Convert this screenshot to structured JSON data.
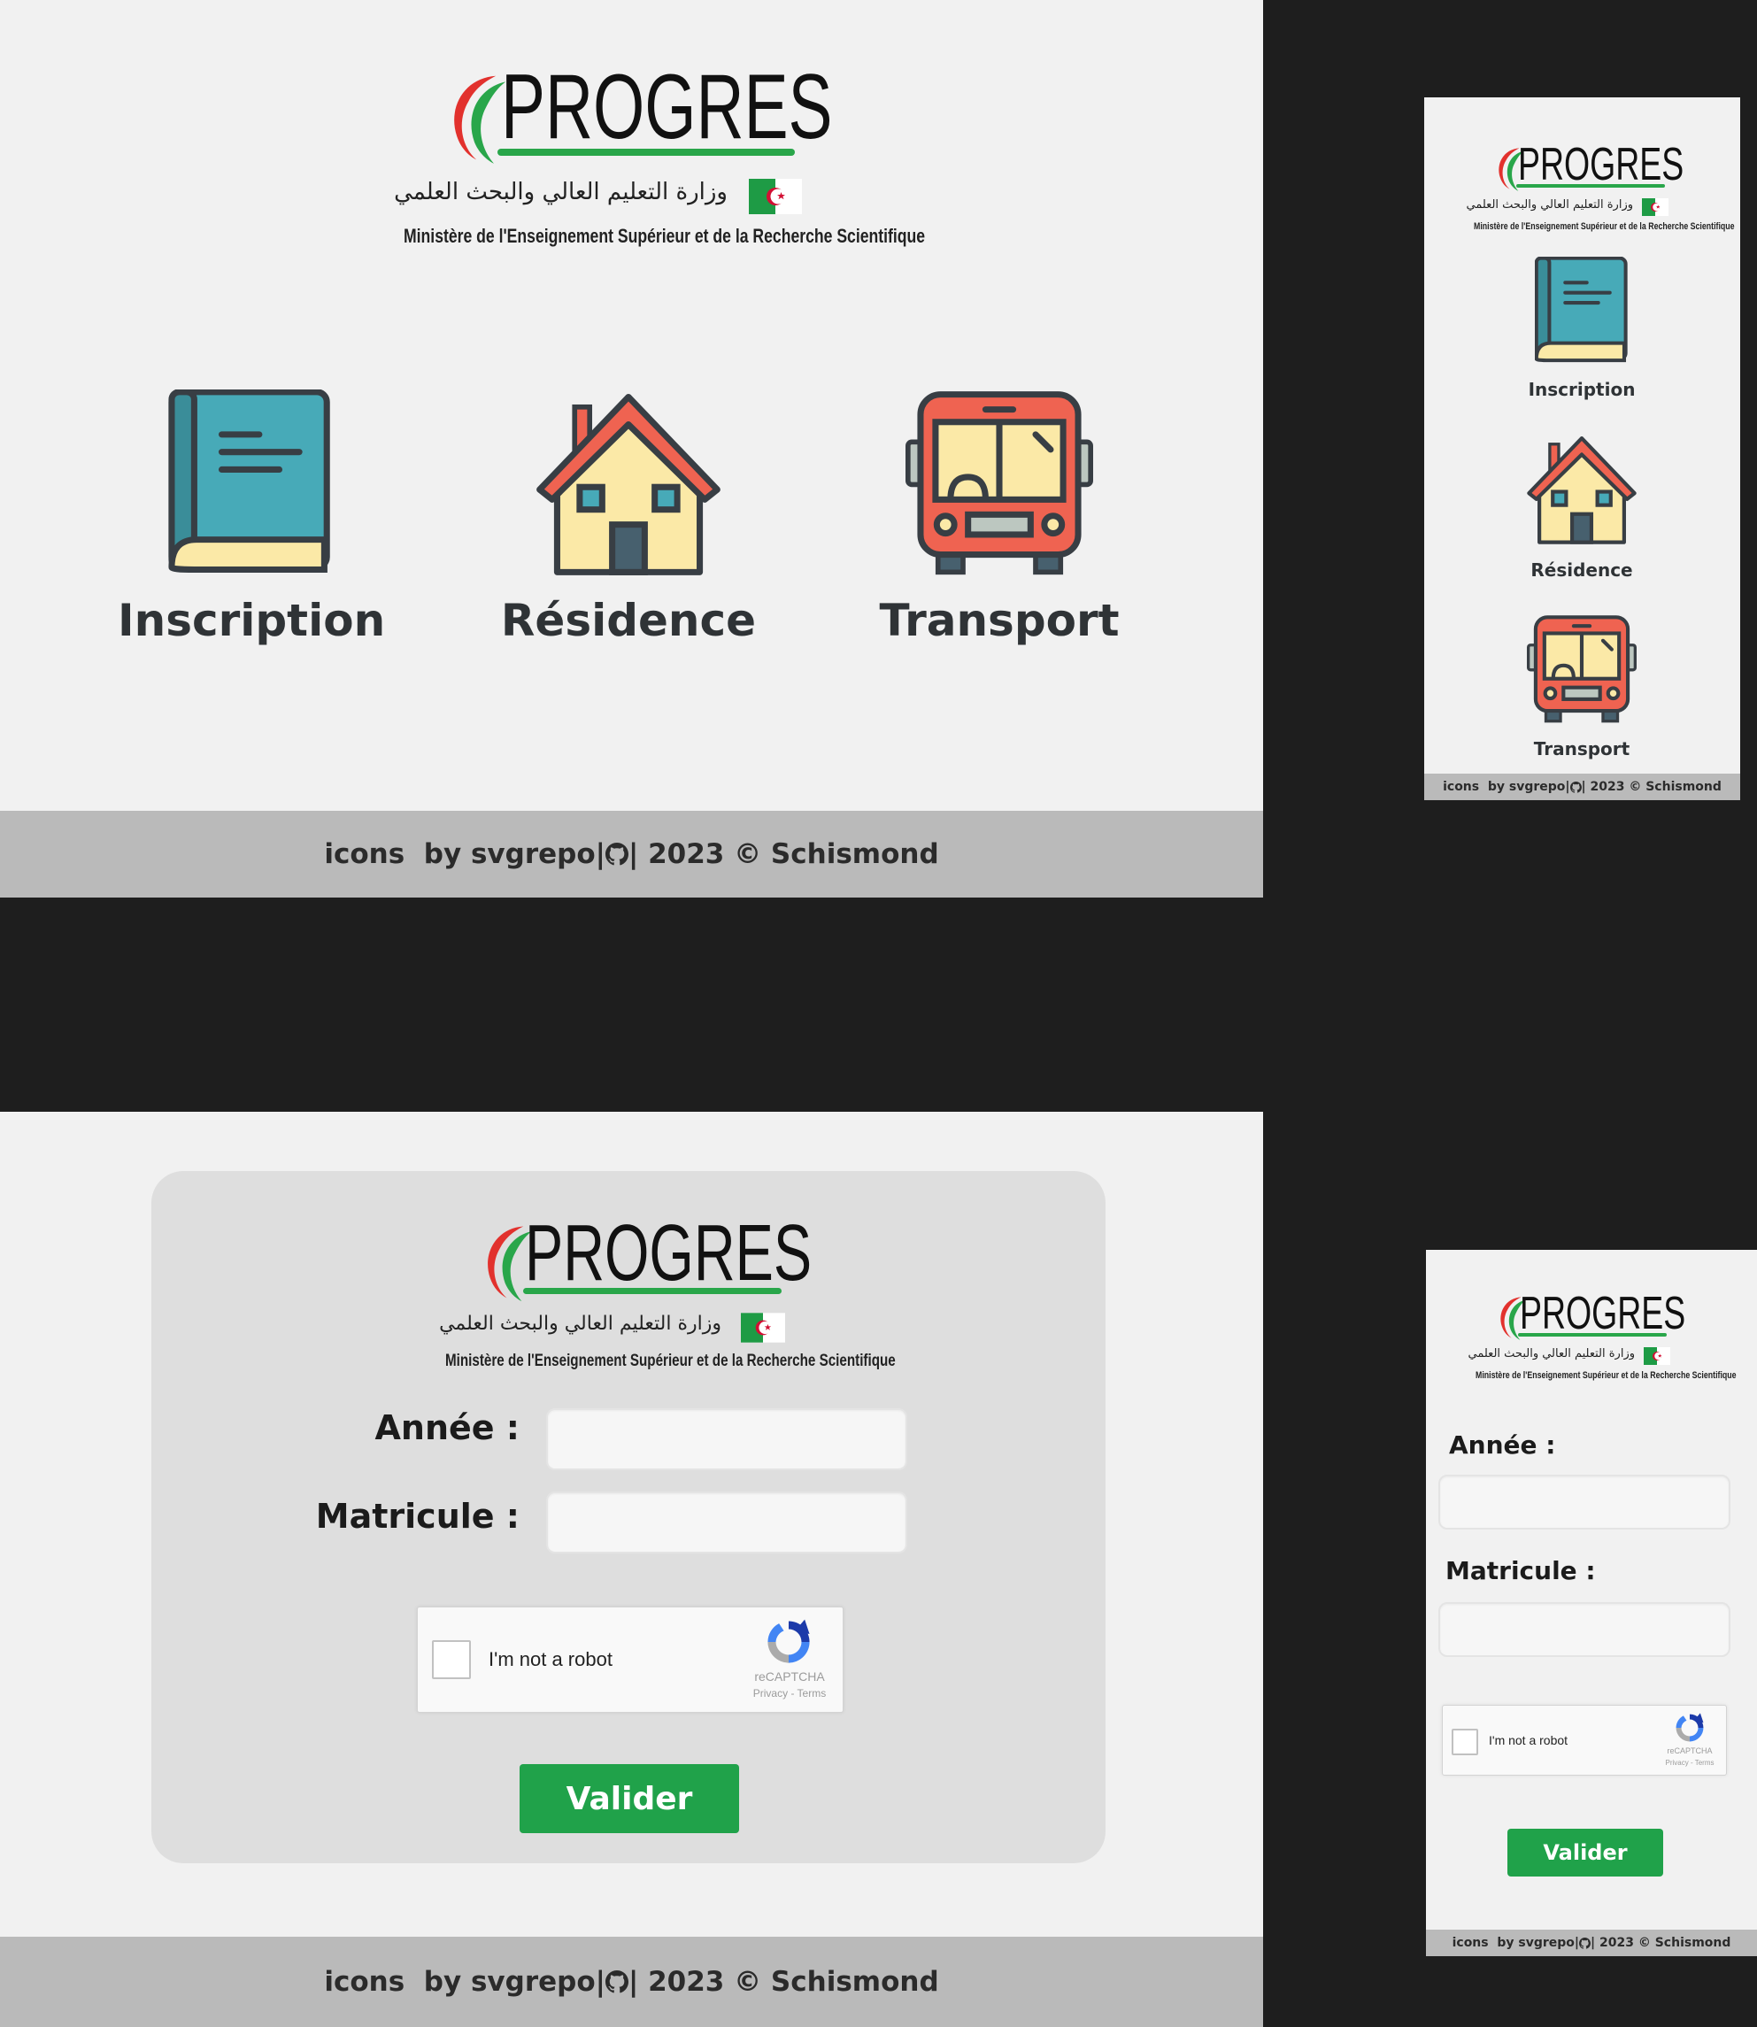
{
  "brand": {
    "name": "PROGRES",
    "arabic": "وزارة التعليم العالي والبحث العلمي",
    "french": "Ministère de l'Enseignement Supérieur et de la Recherche Scientifique"
  },
  "menu": {
    "items": [
      {
        "label": "Inscription",
        "icon": "book-icon"
      },
      {
        "label": "Résidence",
        "icon": "house-icon"
      },
      {
        "label": "Transport",
        "icon": "bus-icon"
      }
    ]
  },
  "footer": {
    "icons_text": "icons",
    "by_text": "by svgrepo|",
    "rest_text": "| 2023 © Schismond"
  },
  "form": {
    "annee_label": "Année :",
    "matricule_label": "Matricule :",
    "annee_value": "",
    "matricule_value": "",
    "captcha_text": "I'm not a robot",
    "captcha_brand": "reCAPTCHA",
    "captcha_links": "Privacy - Terms",
    "submit_label": "Valider"
  },
  "colors": {
    "accent_green": "#20a24a",
    "book_teal": "#47aab8",
    "bus_red": "#ef6351",
    "house_yellow": "#fbe9a7",
    "footer_gray": "#bababa"
  }
}
